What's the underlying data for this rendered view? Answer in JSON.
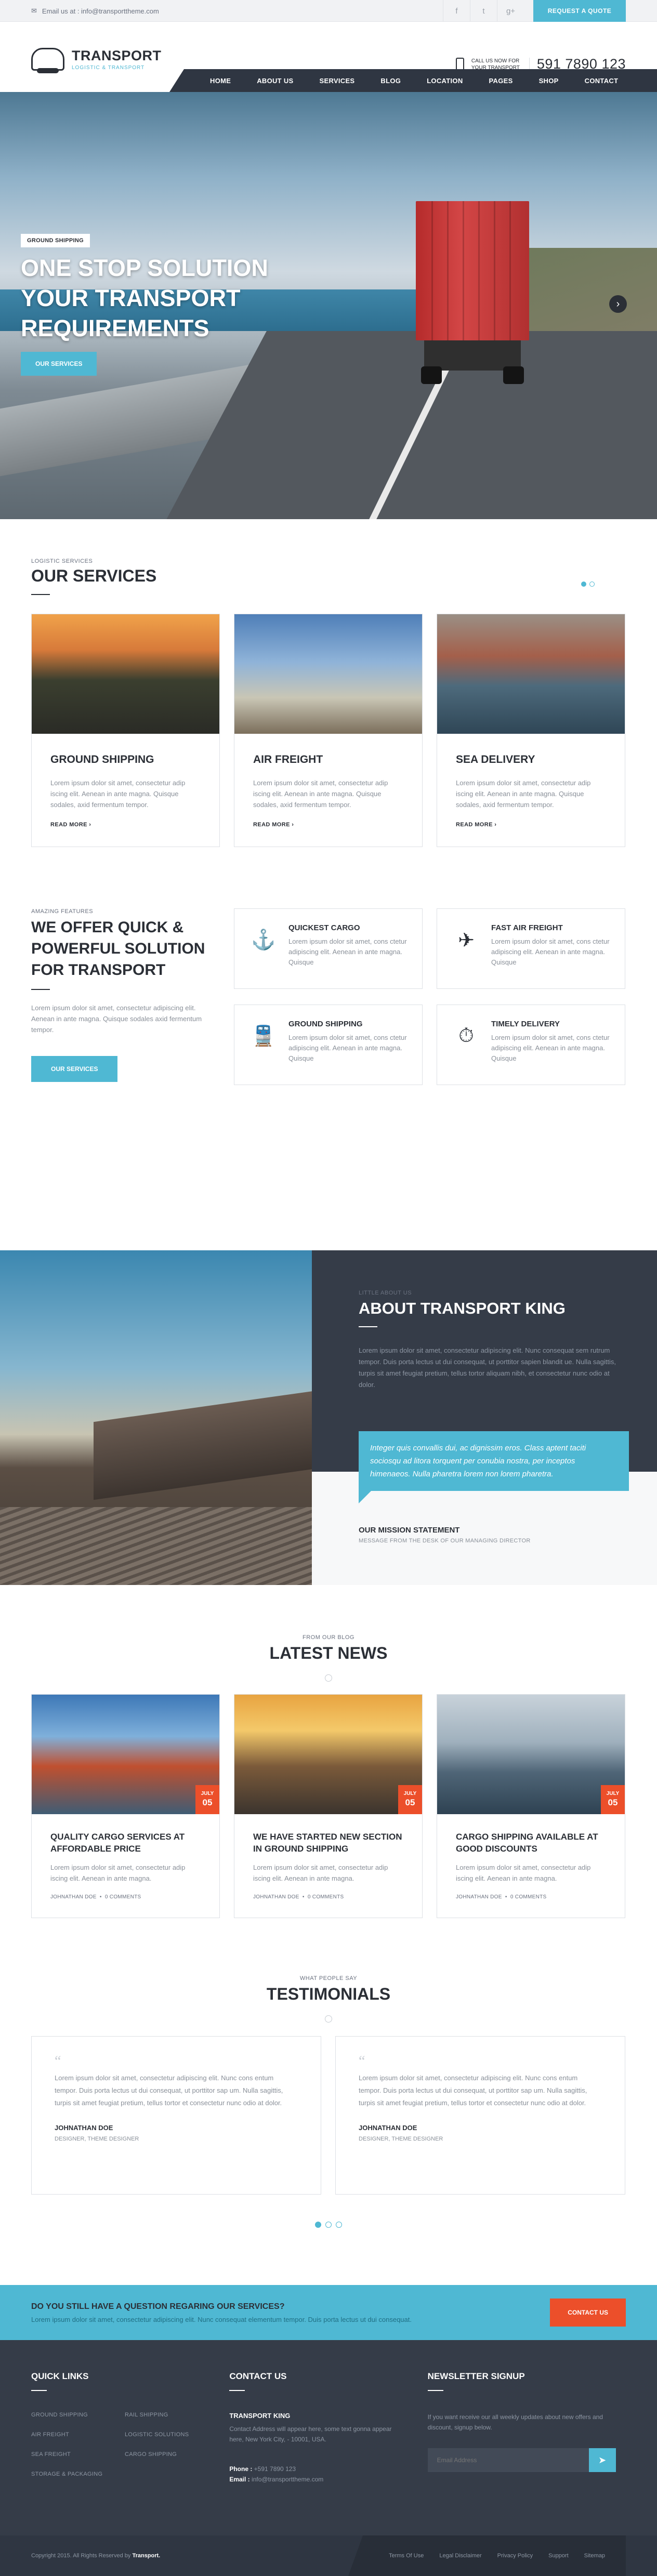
{
  "topbar": {
    "email": "Email us at : info@transporttheme.com",
    "social": [
      "f",
      "t",
      "g+"
    ],
    "quote_button": "REQUEST A QUOTE"
  },
  "header": {
    "logo_title": "TRANSPORT",
    "logo_sub": "LOGISTIC & TRANSPORT",
    "call_line1": "CALL US NOW FOR",
    "call_line2": "YOUR TRANSPORT",
    "phone": "591 7890 123",
    "nav": [
      "HOME",
      "ABOUT US",
      "SERVICES",
      "BLOG",
      "LOCATION",
      "PAGES",
      "SHOP",
      "CONTACT"
    ]
  },
  "hero": {
    "badge": "GROUND SHIPPING",
    "title_line1": "ONE STOP SOLUTION",
    "title_line2": "YOUR TRANSPORT",
    "title_line3": "REQUIREMENTS",
    "button": "OUR SERVICES"
  },
  "services": {
    "kicker": "LOGISTIC SERVICES",
    "title": "OUR SERVICES",
    "items": [
      {
        "title": "GROUND SHIPPING",
        "text": "Lorem ipsum dolor sit amet, consectetur adip iscing elit. Aenean in ante magna. Quisque sodales, axid fermentum tempor.",
        "more": "READ MORE"
      },
      {
        "title": "AIR FREIGHT",
        "text": "Lorem ipsum dolor sit amet, consectetur adip iscing elit. Aenean in ante magna. Quisque sodales, axid fermentum tempor.",
        "more": "READ MORE"
      },
      {
        "title": "SEA DELIVERY",
        "text": "Lorem ipsum dolor sit amet, consectetur adip iscing elit. Aenean in ante magna. Quisque sodales, axid fermentum tempor.",
        "more": "READ MORE"
      }
    ]
  },
  "features": {
    "kicker": "AMAZING FEATURES",
    "title_line1": "WE OFFER QUICK &",
    "title_line2": "POWERFUL SOLUTION",
    "title_line3": "FOR TRANSPORT",
    "text": "Lorem ipsum dolor sit amet, consectetur adipiscing elit. Aenean in ante magna. Quisque sodales axid fermentum tempor.",
    "button": "OUR SERVICES",
    "items": [
      {
        "icon": "⚓",
        "title": "QUICKEST CARGO",
        "text": "Lorem ipsum dolor sit amet, cons ctetur adipiscing elit. Aenean in ante magna. Quisque"
      },
      {
        "icon": "✈",
        "title": "FAST AIR FREIGHT",
        "text": "Lorem ipsum dolor sit amet, cons ctetur adipiscing elit. Aenean in ante magna. Quisque"
      },
      {
        "icon": "🚆",
        "title": "GROUND SHIPPING",
        "text": "Lorem ipsum dolor sit amet, cons ctetur adipiscing elit. Aenean in ante magna. Quisque"
      },
      {
        "icon": "⏱",
        "title": "TIMELY DELIVERY",
        "text": "Lorem ipsum dolor sit amet, cons ctetur adipiscing elit. Aenean in ante magna. Quisque"
      }
    ]
  },
  "about": {
    "kicker": "LITTLE ABOUT US",
    "title": "ABOUT TRANSPORT KING",
    "text": "Lorem ipsum dolor sit amet, consectetur adipiscing elit. Nunc consequat sem rutrum tempor. Duis porta lectus ut dui consequat, ut porttitor sapien blandit ue. Nulla sagittis, turpis sit amet feugiat pretium, tellus tortor aliquam nibh, et consectetur nunc odio at dolor.",
    "quote": "Integer quis convallis dui, ac dignissim eros. Class aptent taciti sociosqu ad litora torquent per conubia nostra, per inceptos himenaeos. Nulla pharetra lorem non lorem pharetra.",
    "mission_title": "OUR MISSION STATEMENT",
    "mission_sub": "MESSAGE FROM THE DESK OF OUR MANAGING DIRECTOR"
  },
  "news": {
    "kicker": "FROM OUR BLOG",
    "title": "LATEST NEWS",
    "items": [
      {
        "month": "JULY",
        "day": "05",
        "title_line1": "QUALITY CARGO SERVICES AT",
        "title_line2": "AFFORDABLE PRICE",
        "text": "Lorem ipsum dolor sit amet, consectetur adip iscing elit. Aenean in ante magna.",
        "author": "JOHNATHAN DOE",
        "comments": "0 COMMENTS"
      },
      {
        "month": "JULY",
        "day": "05",
        "title_line1": "WE HAVE STARTED NEW SECTION",
        "title_line2": "IN GROUND SHIPPING",
        "text": "Lorem ipsum dolor sit amet, consectetur adip iscing elit. Aenean in ante magna.",
        "author": "JOHNATHAN DOE",
        "comments": "0 COMMENTS"
      },
      {
        "month": "JULY",
        "day": "05",
        "title_line1": "CARGO SHIPPING AVAILABLE AT",
        "title_line2": "GOOD DISCOUNTS",
        "text": "Lorem ipsum dolor sit amet, consectetur adip iscing elit. Aenean in ante magna.",
        "author": "JOHNATHAN DOE",
        "comments": "0 COMMENTS"
      }
    ]
  },
  "testimonials": {
    "kicker": "WHAT PEOPLE SAY",
    "title": "TESTIMONIALS",
    "items": [
      {
        "text": "Lorem ipsum dolor sit amet, consectetur adipiscing elit. Nunc cons entum tempor. Duis porta lectus ut dui consequat, ut porttitor sap um. Nulla sagittis, turpis sit amet feugiat pretium, tellus tortor et consectetur nunc odio at dolor.",
        "name": "JOHNATHAN DOE",
        "role": "DESIGNER, THEME DESIGNER"
      },
      {
        "text": "Lorem ipsum dolor sit amet, consectetur adipiscing elit. Nunc cons entum tempor. Duis porta lectus ut dui consequat, ut porttitor sap um. Nulla sagittis, turpis sit amet feugiat pretium, tellus tortor et consectetur nunc odio at dolor.",
        "name": "JOHNATHAN DOE",
        "role": "DESIGNER, THEME DESIGNER"
      }
    ]
  },
  "cta": {
    "title": "DO YOU STILL HAVE A QUESTION REGARING OUR SERVICES?",
    "text": "Lorem ipsum dolor sit amet, consectetur adipiscing elit. Nunc consequat elementum tempor. Duis porta lectus ut dui consequat.",
    "button": "CONTACT US"
  },
  "footer": {
    "quick_links_title": "QUICK LINKS",
    "quick_links": [
      "GROUND SHIPPING",
      "RAIL SHIPPING",
      "AIR FREIGHT",
      "LOGISTIC SOLUTIONS",
      "SEA FREIGHT",
      "CARGO SHIPPING",
      "STORAGE & PACKAGING"
    ],
    "contact_title": "CONTACT US",
    "company": "TRANSPORT KING",
    "address": "Contact Address will appear here, some text gonna appear here, New York City, - 10001, USA.",
    "phone_label": "Phone :",
    "phone": "+591 7890 123",
    "email_label": "Email :",
    "email": "info@transporttheme.com",
    "newsletter_title": "NEWSLETTER SIGNUP",
    "newsletter_text": "If you want receive our all weekly updates about new offers and discount, signup below.",
    "email_placeholder": "Email Address",
    "copyright_prefix": "Copyright 2015. All Rights Reserved by",
    "copyright_brand": "Transport.",
    "bottom_links": [
      "Terms Of Use",
      "Legal Disclaimer",
      "Privacy Policy",
      "Support",
      "Sitemap"
    ]
  },
  "colors": {
    "accent": "#4fb8d3",
    "dark": "#353c48",
    "orange": "#ec4f2a"
  }
}
